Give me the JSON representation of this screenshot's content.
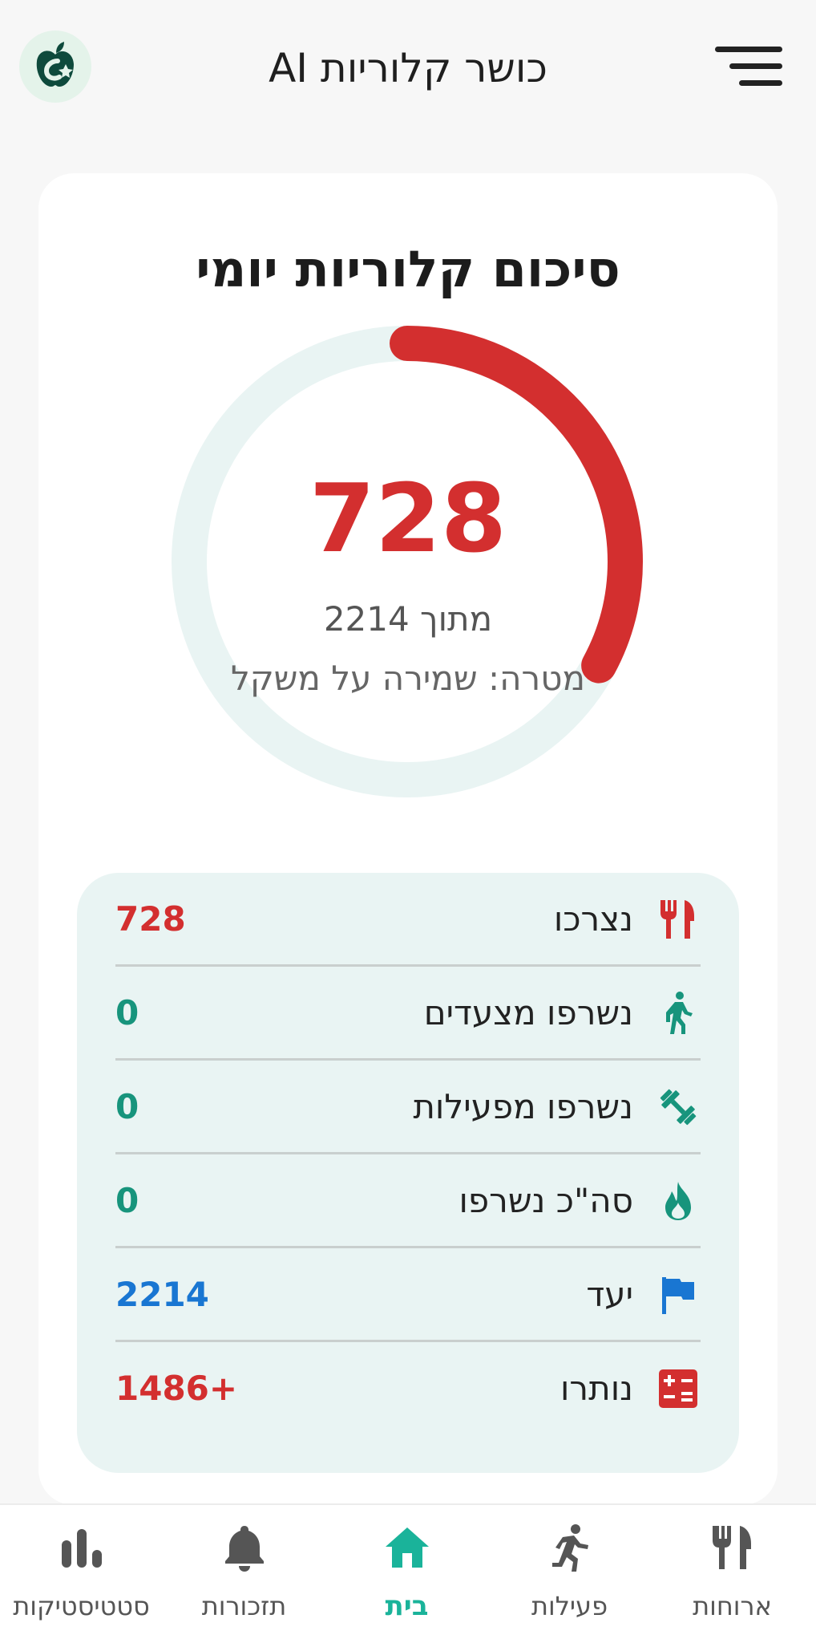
{
  "header": {
    "app_title": "כושר קלוריות AI",
    "logo_icon": "apple-logo-icon",
    "menu_icon": "hamburger-menu-icon"
  },
  "summary_card": {
    "title": "סיכום קלוריות יומי",
    "consumed_value": "728",
    "out_of_text": "מתוך 2214",
    "goal_text": "מטרה: שמירה על משקל",
    "progress_fraction": 0.329,
    "progress_color": "#d32f2f",
    "track_color": "#e9f4f3"
  },
  "breakdown": [
    {
      "label": "נצרכו",
      "value": "728",
      "icon": "fork-knife-icon",
      "icon_color": "#d32f2f",
      "value_color": "#d32f2f"
    },
    {
      "label": "נשרפו מצעדים",
      "value": "0",
      "icon": "walking-icon",
      "icon_color": "#17947c",
      "value_color": "#17947c"
    },
    {
      "label": "נשרפו מפעילות",
      "value": "0",
      "icon": "dumbbell-icon",
      "icon_color": "#17947c",
      "value_color": "#17947c"
    },
    {
      "label": "סה\"כ נשרפו",
      "value": "0",
      "icon": "flame-icon",
      "icon_color": "#17947c",
      "value_color": "#17947c"
    },
    {
      "label": "יעד",
      "value": "2214",
      "icon": "flag-icon",
      "icon_color": "#1976d2",
      "value_color": "#1976d2"
    },
    {
      "label": "נותרו",
      "value": "1486+",
      "icon": "calculator-icon",
      "icon_color": "#d32f2f",
      "value_color": "#d32f2f"
    }
  ],
  "nav": [
    {
      "label": "סטטיסטיקות",
      "icon": "bar-chart-icon",
      "active": false
    },
    {
      "label": "תזכורות",
      "icon": "bell-icon",
      "active": false
    },
    {
      "label": "בית",
      "icon": "home-icon",
      "active": true
    },
    {
      "label": "פעילות",
      "icon": "running-icon",
      "active": false
    },
    {
      "label": "ארוחות",
      "icon": "fork-knife-icon",
      "active": false
    }
  ],
  "colors": {
    "accent": "#1ab39a",
    "inactive_nav": "#555555",
    "brand_dark": "#0e4a3c"
  }
}
